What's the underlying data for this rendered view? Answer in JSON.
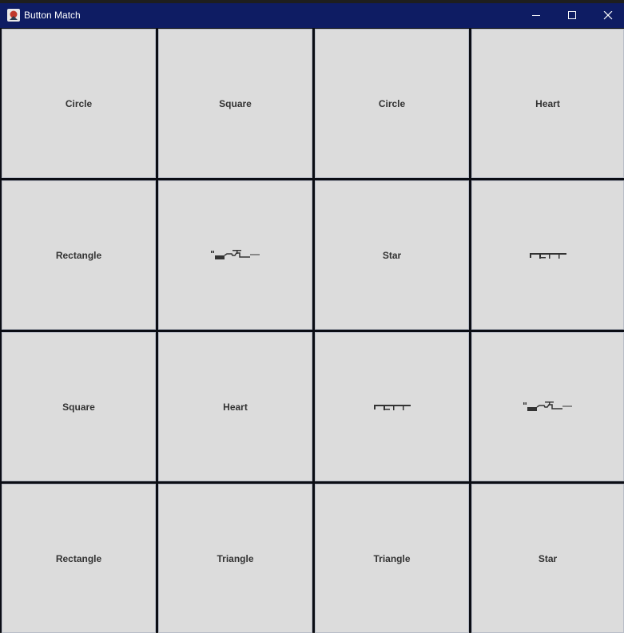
{
  "window": {
    "title": "Button Match",
    "icon": "java-app-icon",
    "controls": [
      "minimize-icon",
      "maximize-icon",
      "close-icon"
    ],
    "titlebar_color": "#0e1c63"
  },
  "board": {
    "cells": [
      {
        "label": "Circle",
        "kind": "text"
      },
      {
        "label": "Square",
        "kind": "text"
      },
      {
        "label": "Circle",
        "kind": "text"
      },
      {
        "label": "Heart",
        "kind": "text"
      },
      {
        "label": "Rectangle",
        "kind": "text"
      },
      {
        "label": "",
        "kind": "garbled-glyph-a"
      },
      {
        "label": "Star",
        "kind": "text"
      },
      {
        "label": "",
        "kind": "garbled-glyph-b"
      },
      {
        "label": "Square",
        "kind": "text"
      },
      {
        "label": "Heart",
        "kind": "text"
      },
      {
        "label": "",
        "kind": "garbled-glyph-b"
      },
      {
        "label": "",
        "kind": "garbled-glyph-a"
      },
      {
        "label": "Rectangle",
        "kind": "text"
      },
      {
        "label": "Triangle",
        "kind": "text"
      },
      {
        "label": "Triangle",
        "kind": "text"
      },
      {
        "label": "Star",
        "kind": "text"
      }
    ],
    "cell_color": "#dcdcdc",
    "text_color": "#333333"
  }
}
